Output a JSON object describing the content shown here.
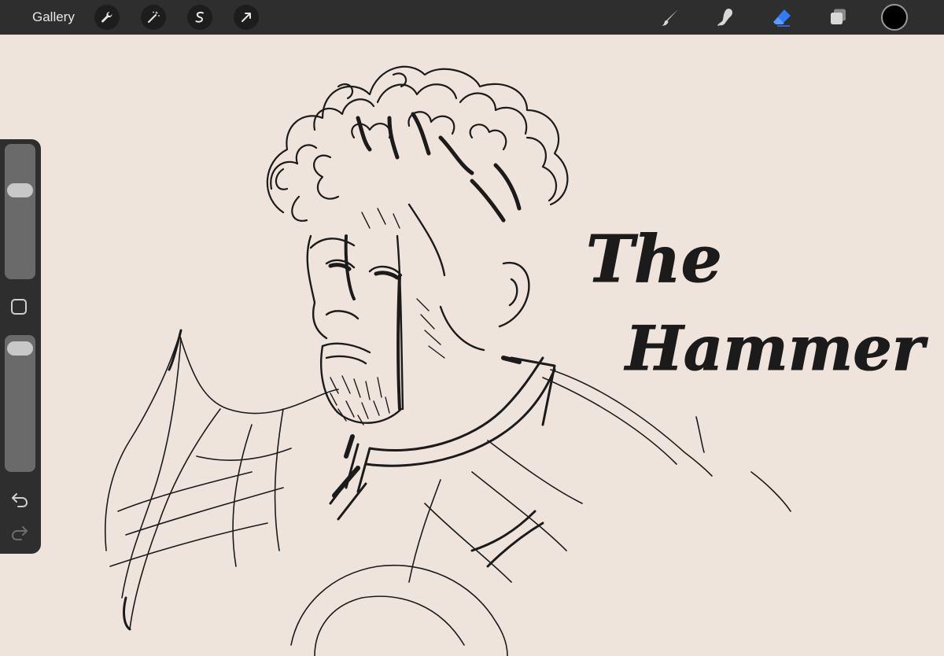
{
  "toolbar": {
    "gallery_label": "Gallery",
    "left_tools": [
      "wrench-icon",
      "magic-wand-icon",
      "selection-icon",
      "transform-icon"
    ],
    "right_tools": [
      "brush-icon",
      "smudge-icon",
      "eraser-icon",
      "layers-icon"
    ],
    "active_tool": "eraser",
    "active_color": "#000000",
    "accent_color": "#2e7cf6"
  },
  "sidebar": {
    "brush_size_level": 0.32,
    "opacity_level": 0.03,
    "undo_icon": "undo-icon",
    "redo_icon": "redo-icon",
    "modify_icon": "modify-square-icon"
  },
  "canvas": {
    "background_color": "#efe4db",
    "lettering_line1": "The",
    "lettering_line2": "Hammer"
  }
}
